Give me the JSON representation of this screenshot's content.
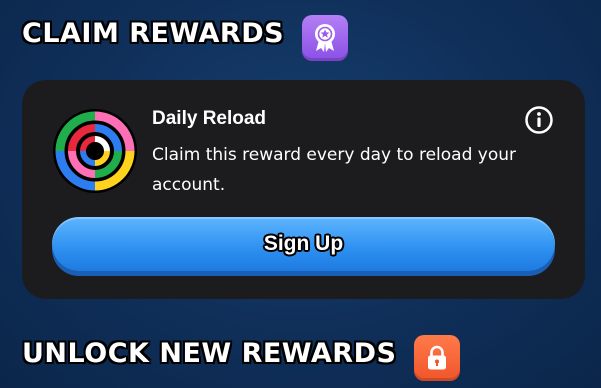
{
  "claim_section": {
    "title": "CLAIM REWARDS",
    "badge_icon": "award-ribbon-icon",
    "badge_color": "#9b5de5"
  },
  "reward_card": {
    "icon": "daily-reload-rings-icon",
    "title": "Daily Reload",
    "description": "Claim this reward every day to reload your account.",
    "info_icon": "info-icon",
    "button_label": "Sign Up",
    "button_color": "#2d8ff0"
  },
  "unlock_section": {
    "title": "UNLOCK NEW REWARDS",
    "badge_icon": "lock-icon",
    "badge_color": "#f0552a"
  }
}
